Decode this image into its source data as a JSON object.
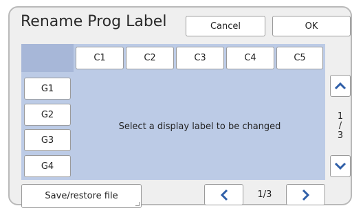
{
  "window": {
    "title": "Rename Prog Label"
  },
  "header": {
    "cancel_label": "Cancel",
    "ok_label": "OK"
  },
  "columns": [
    "C1",
    "C2",
    "C3",
    "C4",
    "C5"
  ],
  "groups": [
    "G1",
    "G2",
    "G3",
    "G4"
  ],
  "message": "Select a display label to be changed",
  "side_pager": {
    "current": "1",
    "separator": "/",
    "total": "3"
  },
  "footer": {
    "save_restore_label": "Save/restore file",
    "page_text": "1/3"
  },
  "icons": {
    "up": "chevron-up-icon",
    "down": "chevron-down-icon",
    "prev": "chevron-left-icon",
    "next": "chevron-right-icon"
  },
  "colors": {
    "panel": "#bccbe6",
    "icon_blue": "#2f5fa8"
  }
}
